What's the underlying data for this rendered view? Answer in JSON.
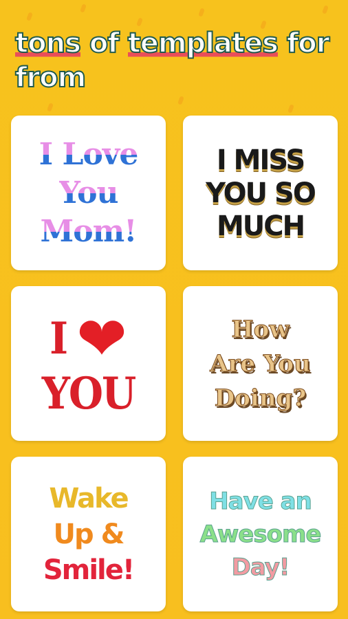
{
  "headline": {
    "line1_part1": "tons",
    "line1_part2": " of ",
    "line1_part3": "templates",
    "line1_part4": " for",
    "line2": "from"
  },
  "templates": [
    {
      "lines": [
        "I Love",
        "You",
        "Mom!"
      ]
    },
    {
      "lines": [
        "I MISS",
        "YOU SO",
        "MUCH"
      ]
    },
    {
      "lines": [
        "I",
        "YOU"
      ],
      "icon": "heart-icon"
    },
    {
      "lines": [
        "How",
        "Are You",
        "Doing?"
      ]
    },
    {
      "lines": [
        "Wake",
        "Up &",
        "Smile!"
      ]
    },
    {
      "lines": [
        "Have an",
        "Awesome",
        "Day!"
      ]
    }
  ],
  "colors": {
    "background": "#f7c21d",
    "headline_text": "#ffffff",
    "headline_outline": "#1f5a4d",
    "underline": "#e94e59"
  }
}
